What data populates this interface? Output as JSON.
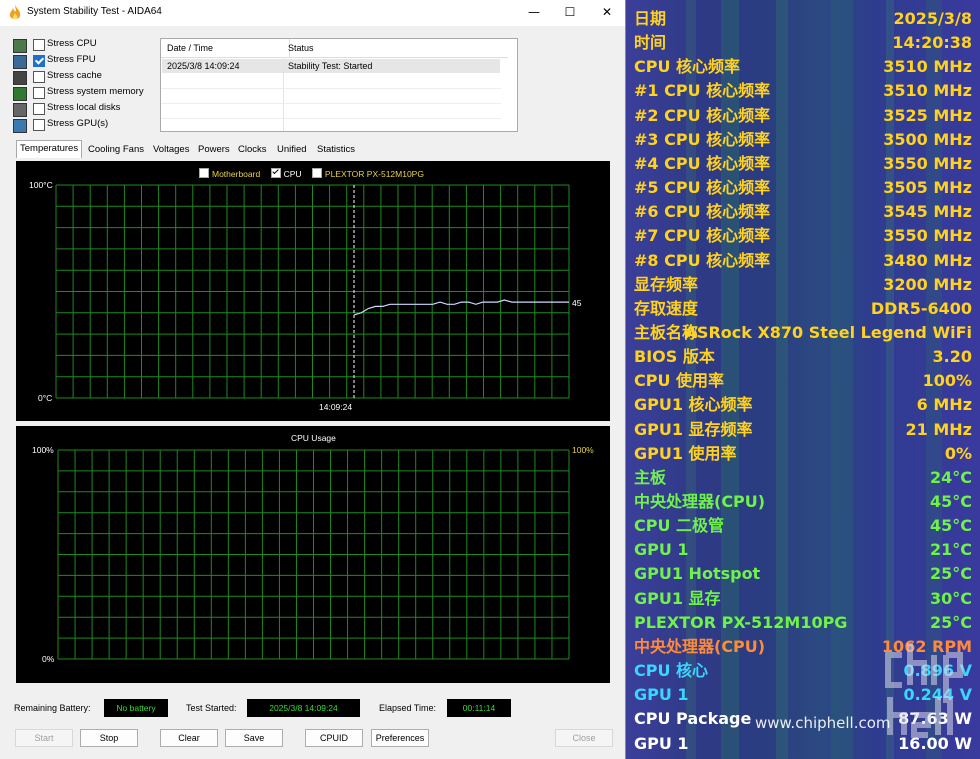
{
  "window": {
    "title": "System Stability Test - AIDA64",
    "minimize": "—",
    "maximize": "☐",
    "close": "✕"
  },
  "stress_options": [
    {
      "label": "Stress CPU",
      "checked": false
    },
    {
      "label": "Stress FPU",
      "checked": true
    },
    {
      "label": "Stress cache",
      "checked": false
    },
    {
      "label": "Stress system memory",
      "checked": false
    },
    {
      "label": "Stress local disks",
      "checked": false
    },
    {
      "label": "Stress GPU(s)",
      "checked": false
    }
  ],
  "log": {
    "headers": {
      "datetime": "Date / Time",
      "status": "Status"
    },
    "rows": [
      {
        "datetime": "2025/3/8 14:09:24",
        "status": "Stability Test: Started"
      }
    ]
  },
  "tabs": [
    "Temperatures",
    "Cooling Fans",
    "Voltages",
    "Powers",
    "Clocks",
    "Unified",
    "Statistics"
  ],
  "temp_chart": {
    "legend": [
      {
        "label": "Motherboard",
        "checked": false,
        "color": "#e8d24a"
      },
      {
        "label": "CPU",
        "checked": true,
        "color": "#ffffff"
      },
      {
        "label": "PLEXTOR PX-512M10PG",
        "checked": false,
        "color": "#e8d24a"
      }
    ],
    "y_max_label": "100°C",
    "y_min_label": "0°C",
    "marker_time": "14:09:24",
    "current_value_label": "45"
  },
  "usage_chart": {
    "title": "CPU Usage",
    "y_max_label": "100%",
    "y_min_label": "0%",
    "current_value_label": "100%"
  },
  "chart_data": [
    {
      "type": "line",
      "title": "",
      "series": [
        {
          "name": "CPU",
          "values": [
            39,
            40,
            42,
            43,
            43,
            44,
            44,
            44,
            44,
            44,
            44,
            44,
            45,
            44,
            44,
            45,
            45,
            44,
            45,
            45,
            45,
            46,
            45,
            45,
            45,
            45,
            45,
            45,
            45,
            45,
            45
          ]
        }
      ],
      "ylim": [
        0,
        100
      ],
      "xlabel": "14:09:24"
    },
    {
      "type": "line",
      "title": "CPU Usage",
      "series": [],
      "ylim": [
        0,
        100
      ]
    }
  ],
  "status_bar": {
    "battery_label": "Remaining Battery:",
    "battery_value": "No battery",
    "started_label": "Test Started:",
    "started_value": "2025/3/8 14:09:24",
    "elapsed_label": "Elapsed Time:",
    "elapsed_value": "00:11:14"
  },
  "buttons": {
    "start": "Start",
    "stop": "Stop",
    "clear": "Clear",
    "save": "Save",
    "cpuid": "CPUID",
    "preferences": "Preferences",
    "close": "Close"
  },
  "osd": [
    {
      "key": "日期",
      "value": "2025/3/8",
      "color": "#ffd21f"
    },
    {
      "key": "时间",
      "value": "14:20:38",
      "color": "#ffd21f"
    },
    {
      "key": "CPU 核心频率",
      "value": "3510 MHz",
      "color": "#ffd21f"
    },
    {
      "key": "#1 CPU 核心频率",
      "value": "3510 MHz",
      "color": "#ffd21f"
    },
    {
      "key": "#2 CPU 核心频率",
      "value": "3525 MHz",
      "color": "#ffd21f"
    },
    {
      "key": "#3 CPU 核心频率",
      "value": "3500 MHz",
      "color": "#ffd21f"
    },
    {
      "key": "#4 CPU 核心频率",
      "value": "3550 MHz",
      "color": "#ffd21f"
    },
    {
      "key": "#5 CPU 核心频率",
      "value": "3505 MHz",
      "color": "#ffd21f"
    },
    {
      "key": "#6 CPU 核心频率",
      "value": "3545 MHz",
      "color": "#ffd21f"
    },
    {
      "key": "#7 CPU 核心频率",
      "value": "3550 MHz",
      "color": "#ffd21f"
    },
    {
      "key": "#8 CPU 核心频率",
      "value": "3480 MHz",
      "color": "#ffd21f"
    },
    {
      "key": "显存频率",
      "value": "3200 MHz",
      "color": "#ffd21f"
    },
    {
      "key": "存取速度",
      "value": "DDR5-6400",
      "color": "#ffd21f"
    },
    {
      "key": "主板名称",
      "value": "ASRock X870 Steel Legend WiFi",
      "color": "#ffd21f"
    },
    {
      "key": "BIOS 版本",
      "value": "3.20",
      "color": "#ffd21f"
    },
    {
      "key": "CPU 使用率",
      "value": "100%",
      "color": "#ffd21f"
    },
    {
      "key": "GPU1 核心频率",
      "value": "6 MHz",
      "color": "#ffd21f"
    },
    {
      "key": "GPU1 显存频率",
      "value": "21 MHz",
      "color": "#ffd21f"
    },
    {
      "key": "GPU1 使用率",
      "value": "0%",
      "color": "#ffd21f"
    },
    {
      "key": "主板",
      "value": "24°C",
      "color": "#6ff24a"
    },
    {
      "key": "中央处理器(CPU)",
      "value": "45°C",
      "color": "#6ff24a"
    },
    {
      "key": "CPU 二极管",
      "value": "45°C",
      "color": "#6ff24a"
    },
    {
      "key": "GPU 1",
      "value": "21°C",
      "color": "#6ff24a"
    },
    {
      "key": "GPU1 Hotspot",
      "value": "25°C",
      "color": "#6ff24a"
    },
    {
      "key": "GPU1 显存",
      "value": "30°C",
      "color": "#6ff24a"
    },
    {
      "key": "PLEXTOR PX-512M10PG",
      "value": "25°C",
      "color": "#6ff24a"
    },
    {
      "key": "中央处理器(CPU)",
      "value": "1062 RPM",
      "color": "#ff8a3a"
    },
    {
      "key": "CPU 核心",
      "value": "0.896 V",
      "color": "#3ad6ff"
    },
    {
      "key": "GPU 1",
      "value": "0.244 V",
      "color": "#3ad6ff"
    },
    {
      "key": "CPU Package",
      "value": "87.63 W",
      "color": "#ffffff"
    },
    {
      "key": "GPU 1",
      "value": "16.00 W",
      "color": "#ffffff"
    }
  ],
  "watermark": "www.chiphell.com"
}
